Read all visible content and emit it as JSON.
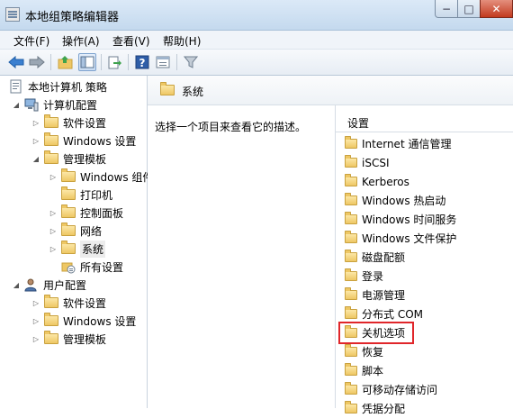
{
  "window": {
    "title": "本地组策略编辑器",
    "min": "−",
    "max": "□",
    "close": "✕"
  },
  "menu": [
    "文件(F)",
    "操作(A)",
    "查看(V)",
    "帮助(H)"
  ],
  "toolbar": {
    "icons": [
      "back-arrow-icon",
      "forward-arrow-icon",
      "up-folder-icon",
      "show-tree-icon",
      "export-list-icon",
      "help-icon",
      "properties-icon",
      "filter-icon"
    ]
  },
  "tree": {
    "root": "本地计算机 策略",
    "computer": "计算机配置",
    "c_software": "软件设置",
    "c_windows": "Windows 设置",
    "c_admin": "管理模板",
    "c_admin_windows": "Windows 组件",
    "c_printers": "打印机",
    "c_control": "控制面板",
    "c_network": "网络",
    "c_system": "系统",
    "c_all": "所有设置",
    "user": "用户配置",
    "u_software": "软件设置",
    "u_windows": "Windows 设置",
    "u_admin": "管理模板"
  },
  "pane": {
    "title": "系统",
    "description": "选择一个项目来查看它的描述。",
    "column": "设置"
  },
  "settings": [
    "Internet 通信管理",
    "iSCSI",
    "Kerberos",
    "Windows 热启动",
    "Windows 时间服务",
    "Windows 文件保护",
    "磁盘配额",
    "登录",
    "电源管理",
    "分布式 COM",
    "关机选项",
    "恢复",
    "脚本",
    "可移动存储访问",
    "凭据分配"
  ],
  "colors": {
    "highlight": "#e0262a",
    "folder": "#eec764"
  }
}
